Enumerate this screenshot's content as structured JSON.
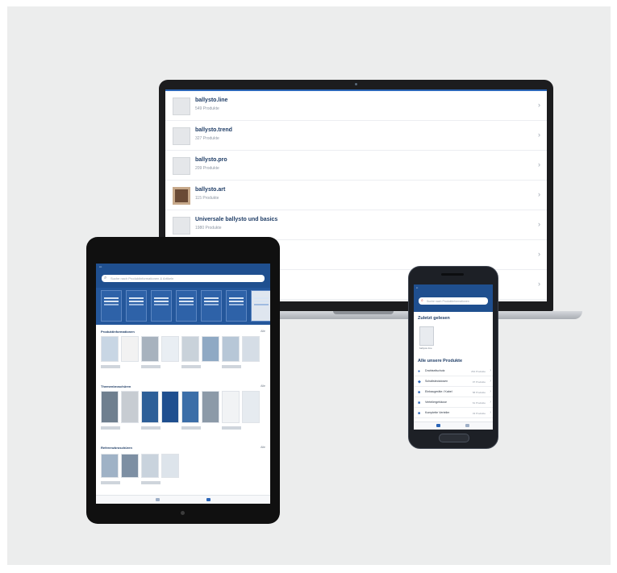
{
  "laptop": {
    "products": [
      {
        "name": "ballysto.line",
        "meta": "549 Produkte"
      },
      {
        "name": "ballysto.trend",
        "meta": "327 Produkte"
      },
      {
        "name": "ballysto.pro",
        "meta": "209 Produkte"
      },
      {
        "name": "ballysto.art",
        "meta": "115 Produkte"
      },
      {
        "name": "Universale ballysto und basics",
        "meta": "1980 Produkte"
      },
      {
        "name": "",
        "meta": ""
      },
      {
        "name": "",
        "meta": ""
      }
    ],
    "chevron": "›"
  },
  "tablet": {
    "search_placeholder": "Suche nach Produktinformationen & Artikeln",
    "sections": [
      {
        "title": "Produktinformationen",
        "more": "Alle"
      },
      {
        "title": "Themenbroschüren",
        "more": "Alle"
      },
      {
        "title": "Referenzbroschüren",
        "more": "Alle"
      }
    ]
  },
  "phone": {
    "search_placeholder": "Suche nach Produktinformationen",
    "recent_title": "Zuletzt gelesen",
    "recent_item": "ballysto.line",
    "products_title": "Alle unsere Produkte",
    "rows": [
      {
        "label": "Drahtseilschutz",
        "count": "264 Produkte",
        "icon": "pin-icon"
      },
      {
        "label": "Schaltsteckdosen",
        "count": "97 Produkte",
        "icon": "plug-icon"
      },
      {
        "label": "Einbaugeräte / Kabel",
        "count": "58 Produkte",
        "icon": "box-icon"
      },
      {
        "label": "Verteilergehäuse",
        "count": "61 Produkte",
        "icon": "box-icon"
      },
      {
        "label": "Komplette Verteiler",
        "count": "43 Produkte",
        "icon": "box-icon"
      }
    ]
  },
  "colors": {
    "brand_blue": "#1f4f8f",
    "accent_blue": "#2c66b8",
    "backdrop": "#eceded"
  }
}
